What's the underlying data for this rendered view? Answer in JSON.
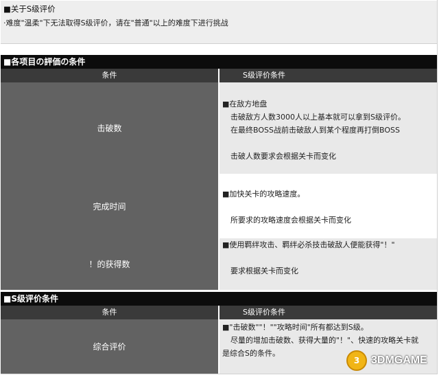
{
  "note": {
    "title": "■关于S级评价",
    "text": "·难度\"温柔\"下无法取得S级评价，请在\"普通\"以上的难度下进行挑战"
  },
  "section1": {
    "title": "■各项目の評価の条件",
    "col_left": "条件",
    "col_right": "S级评价条件",
    "rows": [
      {
        "label": "击破数",
        "lines": [
          "■在敌方地盘",
          "击破敌方人数3000人以上基本就可以拿到S级评价。",
          "在最终BOSS战前击破敌人到某个程度再打倒BOSS",
          "",
          "击破人数要求会根据关卡而变化"
        ]
      },
      {
        "label": "完成时间",
        "lines": [
          "■加快关卡的攻略速度。",
          "",
          "所要求的攻略速度会根据关卡而变化"
        ]
      },
      {
        "label": "！的获得数",
        "lines": [
          "■使用羁绊攻击、羁绊必杀技击破敌人便能获得\"！\"",
          "",
          "要求根据关卡而变化"
        ]
      }
    ]
  },
  "section2": {
    "title": "■S级评价条件",
    "col_left": "条件",
    "col_right": "S级评价条件",
    "rows": [
      {
        "label": "综合评价",
        "lines": [
          "■\"击破数\"\"！\"\"攻略时间\"所有都达到S级。",
          "尽量的增加击破数、获得大量的\"！\"、快速的攻略关卡就",
          "是综合S的条件。"
        ]
      }
    ]
  },
  "watermark": {
    "badge": "3",
    "text": "3DMGAME"
  }
}
